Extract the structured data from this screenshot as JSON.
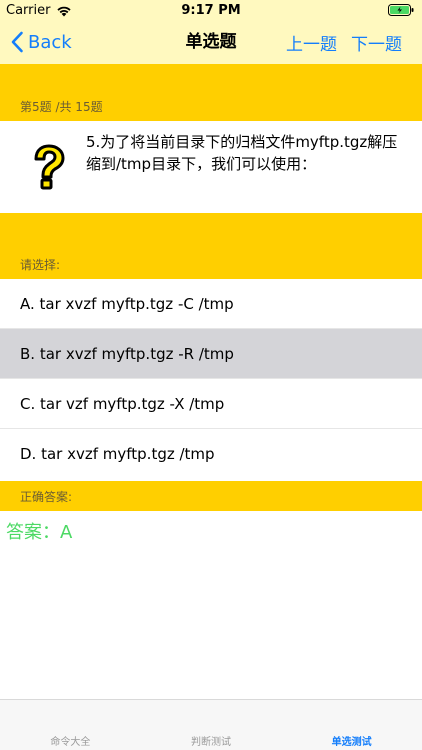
{
  "status_bar": {
    "carrier": "Carrier",
    "time": "9:17 PM"
  },
  "nav": {
    "back_label": "Back",
    "title": "单选题",
    "prev_label": "上一题",
    "next_label": "下一题"
  },
  "progress": {
    "label": "第5题 /共 15题"
  },
  "question": {
    "icon": "question-mark-icon",
    "text": "5.为了将当前目录下的归档文件myftp.tgz解压缩到/tmp目录下，我们可以使用："
  },
  "select_label": "请选择:",
  "options": [
    {
      "label": "A. tar xvzf myftp.tgz -C /tmp"
    },
    {
      "label": "B. tar xvzf myftp.tgz -R /tmp"
    },
    {
      "label": "C. tar vzf myftp.tgz -X /tmp"
    },
    {
      "label": "D. tar xvzf myftp.tgz /tmp"
    }
  ],
  "selected_option": 1,
  "answer_label": "正确答案:",
  "answer_text": "答案：A",
  "tabs": [
    {
      "label": "命令大全"
    },
    {
      "label": "判断测试"
    },
    {
      "label": "单选测试"
    }
  ],
  "active_tab": 2,
  "colors": {
    "accent": "#147efb",
    "band": "#ffcf00",
    "top_bg": "#fff9bf",
    "answer": "#4cd964",
    "selected_row": "#d4d4d8"
  }
}
